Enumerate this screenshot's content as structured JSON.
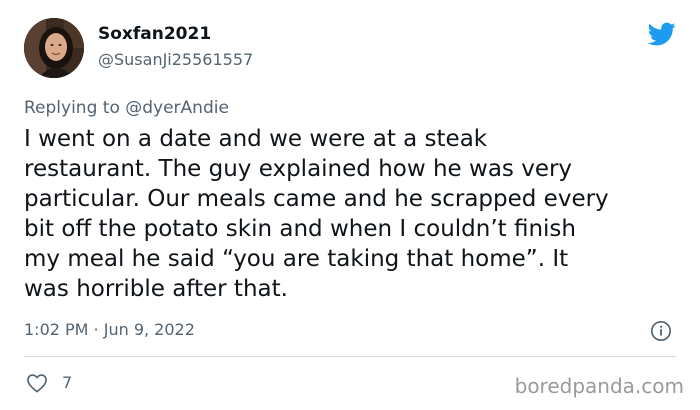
{
  "author": {
    "display_name": "Soxfan2021",
    "handle": "@SusanJi25561557"
  },
  "reply": {
    "prefix": "Replying to",
    "mention": "@dyerAndie"
  },
  "tweet": {
    "lines": [
      "I went on a date and we were at a steak",
      "restaurant. The guy explained how he was very",
      "particular. Our meals came and he scrapped every",
      "bit off the potato skin and when I couldn’t finish",
      "my meal he said “you are taking that home”. It",
      "was horrible after that."
    ],
    "timestamp": "1:02 PM · Jun 9, 2022"
  },
  "actions": {
    "like_count": "7"
  },
  "watermark": "boredpanda.com",
  "icons": {
    "brand": "twitter-bird-icon",
    "info": "info-icon",
    "like": "heart-icon"
  },
  "colors": {
    "brand_blue": "#1d9bf0",
    "secondary_text": "#536471",
    "primary_text": "#0f1419",
    "divider": "#cfd9de"
  }
}
